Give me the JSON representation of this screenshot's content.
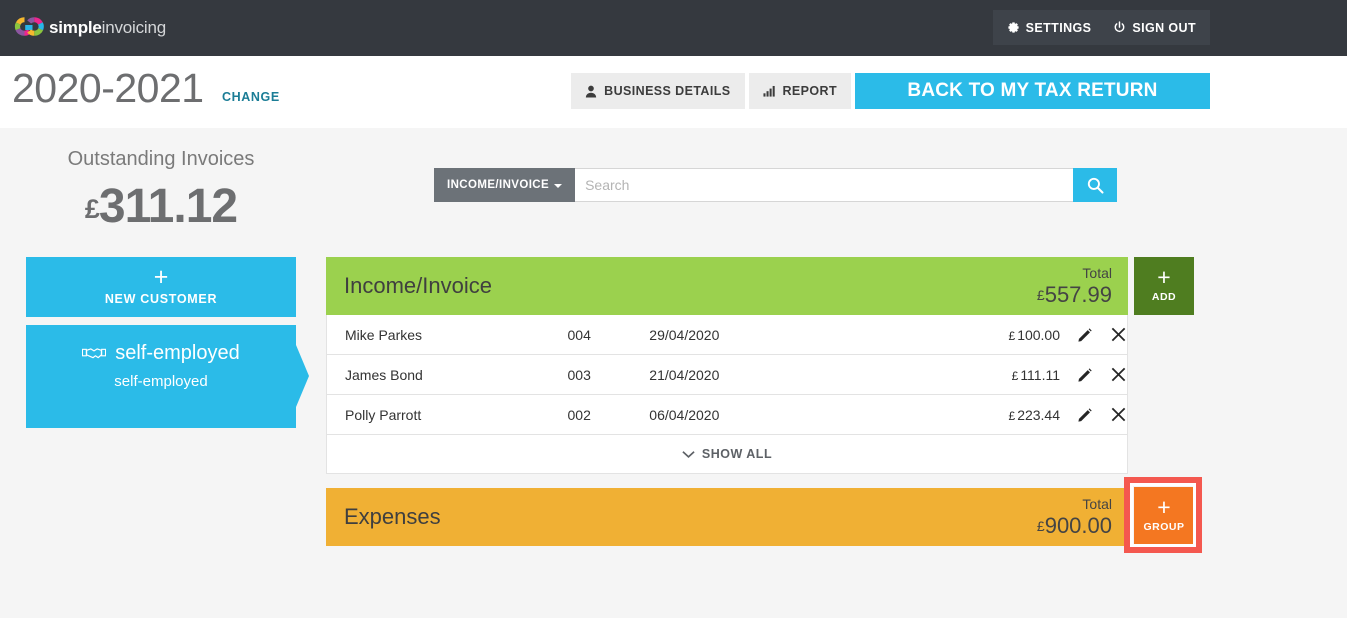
{
  "topnav": {
    "logo_text_bold": "simple",
    "logo_text_light": "invoicing",
    "logo_icon": "simpleinvoicing-logo",
    "settings_label": "SETTINGS",
    "settings_icon": "gear-icon",
    "signout_label": "SIGN OUT",
    "signout_icon": "power-icon",
    "background": "#35393f",
    "panel_background": "#3e434a"
  },
  "header": {
    "year_title": "2020-2021",
    "change_label": "CHANGE",
    "change_color": "#1b7d96",
    "business_details_label": "BUSINESS DETAILS",
    "business_details_icon": "person-icon",
    "report_label": "REPORT",
    "report_icon": "bar-chart-icon",
    "back_label": "BACK TO MY TAX RETURN",
    "accent": "#2bbbe8"
  },
  "sidebar": {
    "outstanding_label": "Outstanding Invoices",
    "outstanding_currency": "£",
    "outstanding_amount": "311.12",
    "new_customer_label": "NEW CUSTOMER",
    "new_customer_icon": "plus-icon",
    "customer": {
      "name": "self-employed",
      "subtitle": "self-employed",
      "icon": "handshake-icon"
    }
  },
  "search": {
    "dropdown_label": "INCOME/INVOICE",
    "dropdown_icon": "chevron-down-icon",
    "placeholder": "Search",
    "value": "",
    "search_icon": "magnifier-icon"
  },
  "income_panel": {
    "title": "Income/Invoice",
    "total_label": "Total",
    "total_currency": "£",
    "total_amount": "557.99",
    "header_color": "#9bd14e",
    "add_button": {
      "label": "ADD",
      "icon": "plus-icon",
      "color": "#4f7d20"
    },
    "rows": [
      {
        "name": "Mike Parkes",
        "number": "004",
        "date": "29/04/2020",
        "currency": "£",
        "amount": "100.00",
        "edit_icon": "pencil-icon",
        "delete_icon": "close-icon"
      },
      {
        "name": "James Bond",
        "number": "003",
        "date": "21/04/2020",
        "currency": "£",
        "amount": "111.11",
        "edit_icon": "pencil-icon",
        "delete_icon": "close-icon"
      },
      {
        "name": "Polly Parrott",
        "number": "002",
        "date": "06/04/2020",
        "currency": "£",
        "amount": "223.44",
        "edit_icon": "pencil-icon",
        "delete_icon": "close-icon"
      }
    ],
    "show_all_label": "SHOW ALL",
    "show_all_icon": "chevron-down-icon"
  },
  "expenses_panel": {
    "title": "Expenses",
    "total_label": "Total",
    "total_currency": "£",
    "total_amount": "900.00",
    "header_color": "#f0b034",
    "group_button": {
      "label": "GROUP",
      "icon": "plus-icon",
      "color": "#f47721"
    },
    "highlight_color": "#f4584f"
  }
}
